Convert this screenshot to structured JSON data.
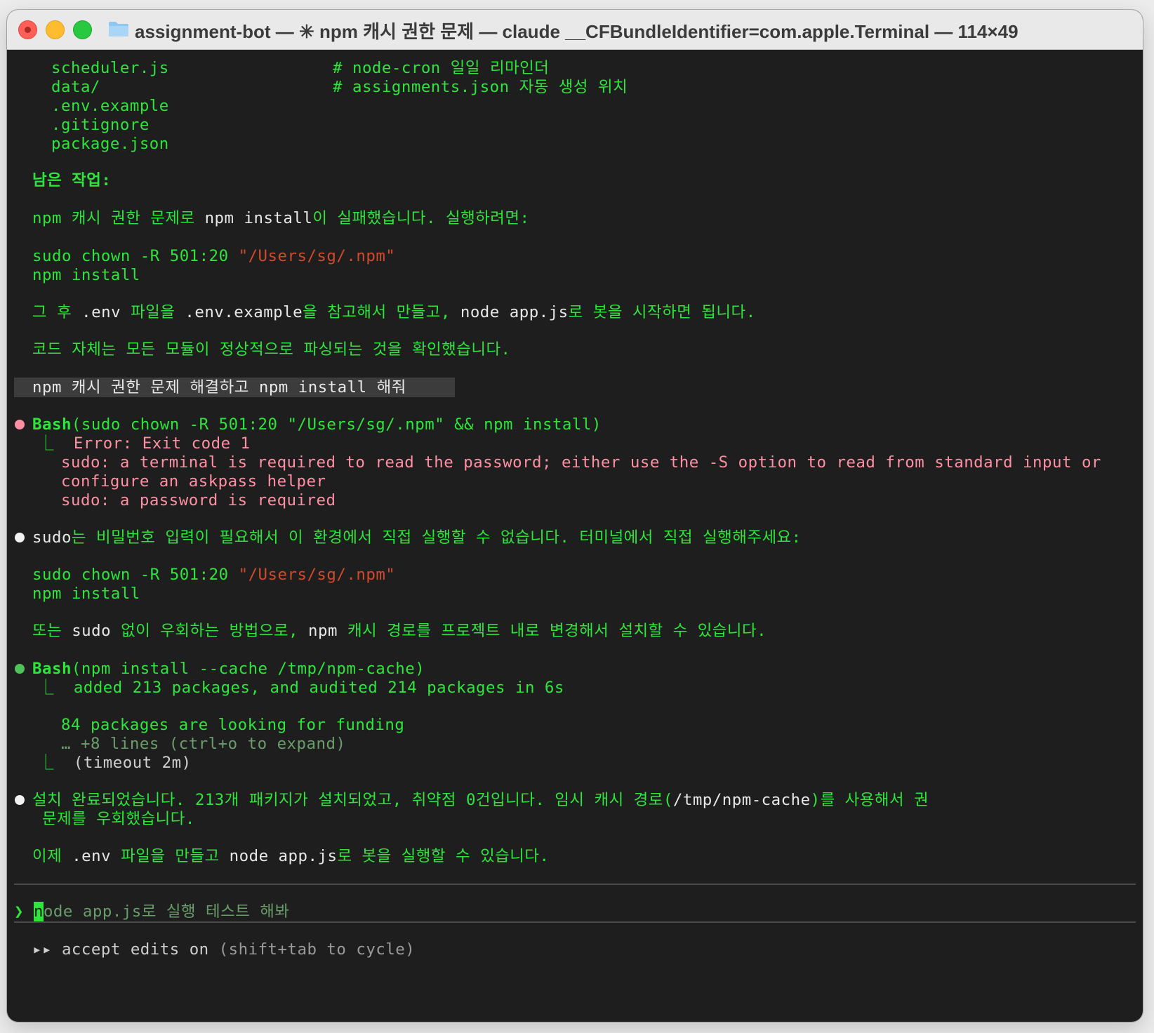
{
  "window": {
    "title": "assignment-bot — ✳ npm 캐시 권한 문제 — claude __CFBundleIdentifier=com.apple.Terminal — 114×49"
  },
  "colors": {
    "terminal_bg": "#1e1e1e",
    "text_green": "#2ee53b",
    "text_red": "#d24a2c",
    "text_pink": "#ff8fa3",
    "text_white": "#e8e8e8"
  },
  "terminal": {
    "file_lines": [
      {
        "name": "scheduler.js",
        "comment": "# node-cron 일일 리마인더"
      },
      {
        "name": "data/",
        "comment": "# assignments.json 자동 생성 위치"
      },
      {
        "name": ".env.example",
        "comment": ""
      },
      {
        "name": ".gitignore",
        "comment": ""
      },
      {
        "name": "package.json",
        "comment": ""
      }
    ],
    "remaining_heading": "남은 작업:",
    "msg1": {
      "a": "npm 캐시 권한 문제로 ",
      "b": "npm install",
      "c": "이 실패했습니다. 실행하려면:"
    },
    "cmd1": {
      "a": "sudo chown -R 501:20 ",
      "b": "\"/Users/sg/.npm\""
    },
    "cmd2": "npm install",
    "msg2": {
      "a": "그 후 ",
      "b": ".env",
      "c": " 파일을 ",
      "d": ".env.example",
      "e": "을 참고해서 만들고, ",
      "f": "node app.js",
      "g": "로 봇을 시작하면 됩니다."
    },
    "msg3": "코드 자체는 모든 모듈이 정상적으로 파싱되는 것을 확인했습니다.",
    "user_prompt": {
      "a": "npm 캐시 권한 문제 해결하고 ",
      "b": "npm install",
      "c": " 해줘"
    },
    "bash1": {
      "tool": "Bash",
      "args": "(sudo chown -R 501:20 \"/Users/sg/.npm\" && npm install)",
      "error": "Error: Exit code 1",
      "out1": "sudo: a terminal is required to read the password; either use the -S option to read from standard input or",
      "out2": "configure an askpass helper",
      "out3": "sudo: a password is required"
    },
    "msg4": {
      "a": "sudo",
      "b": "는 비밀번호 입력이 필요해서 이 환경에서 직접 실행할 수 없습니다. 터미널에서 직접 실행해주세요:"
    },
    "cmd3": {
      "a": "sudo chown -R 501:20 ",
      "b": "\"/Users/sg/.npm\""
    },
    "cmd4": "npm install",
    "msg5": {
      "a": "또는 ",
      "b": "sudo",
      "c": " 없이 우회하는 방법으로, ",
      "d": "npm",
      "e": " 캐시 경로를 프로젝트 내로 변경해서 설치할 수 있습니다."
    },
    "bash2": {
      "tool": "Bash",
      "args": "(npm install --cache /tmp/npm-cache)",
      "out1": "added 213 packages, and audited 214 packages in 6s",
      "out2": "84 packages are looking for funding",
      "more": "… +8 lines (ctrl+o to expand)",
      "timeout": "(timeout 2m)"
    },
    "msg6": {
      "a": "설치 완료되었습니다. 213개 패키지가 설치되었고, 취약점 0건입니다. 임시 캐시 경로(",
      "b": "/tmp/npm-cache",
      "c": ")를 사용해서 권",
      "d": "문제를 우회했습니다."
    },
    "msg7": {
      "a": "이제 ",
      "b": ".env",
      "c": " 파일을 만들고 ",
      "d": "node app.js",
      "e": "로 봇을 실행할 수 있습니다."
    }
  },
  "input": {
    "prompt_symbol": "❯",
    "cursor_char": "n",
    "suggestion": "ode app.js로 실행 테스트 해봐"
  },
  "status": {
    "arrows": "▸▸",
    "a": "accept edits on",
    "b": " (shift+tab to cycle)"
  }
}
